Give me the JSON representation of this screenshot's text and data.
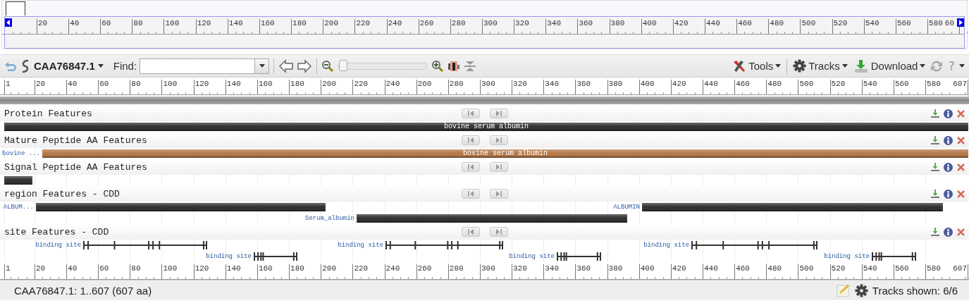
{
  "overview": {
    "ruler_labels": [
      "20",
      "40",
      "60",
      "80",
      "100",
      "120",
      "140",
      "160",
      "180",
      "200",
      "220",
      "240",
      "260",
      "280",
      "300",
      "320",
      "340",
      "360",
      "380",
      "400",
      "420",
      "440",
      "460",
      "480",
      "500",
      "520",
      "540",
      "560",
      "580",
      "60"
    ]
  },
  "toolbar": {
    "sequence_id": "CAA76847.1",
    "find_label": "Find:",
    "zoom": {
      "level": 0
    },
    "menus": [
      {
        "label": "Tools"
      },
      {
        "label": "Tracks"
      },
      {
        "label": "Download"
      }
    ],
    "help": "?"
  },
  "ruler": {
    "labels": [
      "1",
      "20",
      "40",
      "60",
      "80",
      "100",
      "120",
      "140",
      "160",
      "180",
      "200",
      "220",
      "240",
      "260",
      "280",
      "300",
      "320",
      "340",
      "360",
      "380",
      "400",
      "420",
      "440",
      "460",
      "480",
      "500",
      "520",
      "540",
      "560",
      "580",
      "607"
    ]
  },
  "tracks": [
    {
      "title": "Protein Features",
      "features": [
        {
          "kind": "bar",
          "caption": "bovine serum albumin",
          "color": "#333333"
        }
      ]
    },
    {
      "title": "Mature Peptide AA Features",
      "features": [
        {
          "kind": "bar",
          "label": "bovine ...",
          "caption": "bovine serum albumin",
          "color": "#b5794a"
        }
      ]
    },
    {
      "title": "Signal Peptide AA Features",
      "features": [
        {
          "kind": "bar",
          "color": "#333333"
        }
      ]
    },
    {
      "title": "region Features - CDD",
      "features": [
        {
          "kind": "bar",
          "label": "ALBUM...",
          "color": "#333333"
        },
        {
          "kind": "bar",
          "label": "ALBUMIN",
          "color": "#333333"
        },
        {
          "kind": "bar",
          "label": "Serum_albumin",
          "color": "#333333"
        }
      ]
    },
    {
      "title": "site Features - CDD",
      "features": [
        {
          "kind": "site",
          "label": "binding site",
          "color": "#333333"
        },
        {
          "kind": "site",
          "label": "binding site",
          "color": "#333333"
        },
        {
          "kind": "site",
          "label": "binding site",
          "color": "#333333"
        },
        {
          "kind": "site",
          "label": "binding site",
          "color": "#333333"
        },
        {
          "kind": "site",
          "label": "binding site",
          "color": "#333333"
        },
        {
          "kind": "site",
          "label": "binding site",
          "color": "#333333"
        }
      ]
    }
  ],
  "bottom_ruler": {
    "labels": [
      "1",
      "20",
      "40",
      "60",
      "80",
      "100",
      "120",
      "140",
      "160",
      "180",
      "200",
      "220",
      "240",
      "260",
      "280",
      "300",
      "320",
      "340",
      "360",
      "380",
      "400",
      "420",
      "440",
      "460",
      "480",
      "500",
      "520",
      "540",
      "560",
      "580",
      "607"
    ]
  },
  "status_bar": {
    "range": "CAA76847.1: 1..607 (607 aa)",
    "tracks_shown": "Tracks shown: 6/6"
  }
}
